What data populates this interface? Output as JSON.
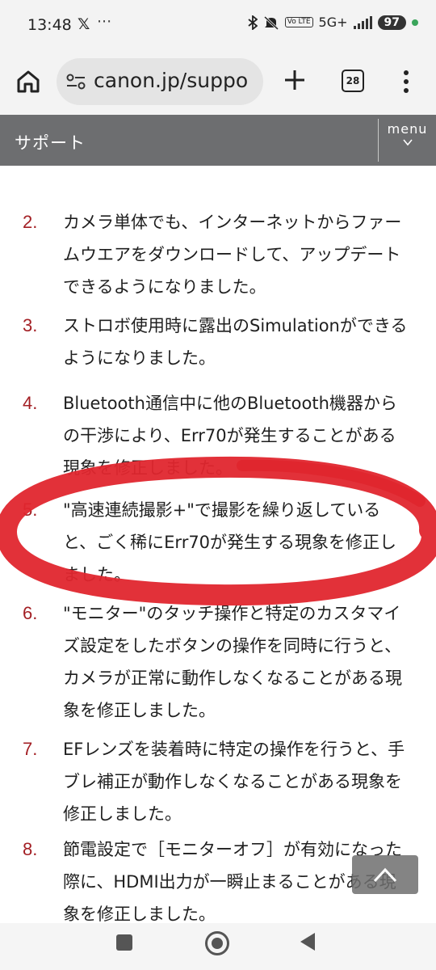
{
  "status_bar": {
    "time": "13:48",
    "x_label": "𝕏",
    "dots": "···",
    "network": "5G+",
    "volte": "Vo LTE",
    "battery": "97"
  },
  "browser": {
    "url": "canon.jp/suppo",
    "tab_count": "28"
  },
  "site_header": {
    "title": "サポート",
    "menu_label": "menu"
  },
  "content": {
    "items": [
      {
        "num": "2.",
        "text": "カメラ単体でも、インターネットからファームウエアをダウンロードして、アップデートできるようになりました。"
      },
      {
        "num": "3.",
        "text": "ストロボ使用時に露出のSimulationができるようになりました。"
      },
      {
        "num": "4.",
        "text": "Bluetooth通信中に他のBluetooth機器からの干渉により、Err70が発生することがある現象を修正しました。"
      },
      {
        "num": "5.",
        "text": "\"高速連続撮影+\"で撮影を繰り返していると、ごく稀にErr70が発生する現象を修正しました。"
      },
      {
        "num": "6.",
        "text": "\"モニター\"のタッチ操作と特定のカスタマイズ設定をしたボタンの操作を同時に行うと、カメラが正常に動作しなくなることがある現象を修正しました。"
      },
      {
        "num": "7.",
        "text": "EFレンズを装着時に特定の操作を行うと、手ブレ補正が動作しなくなることがある現象を修正しました。"
      },
      {
        "num": "8.",
        "text": "節電設定で［モニターオフ］が有効になった際に、HDMI出力が一瞬止まることがある現象を修正しました。"
      }
    ]
  },
  "annotation": {
    "color": "#e0262e"
  }
}
